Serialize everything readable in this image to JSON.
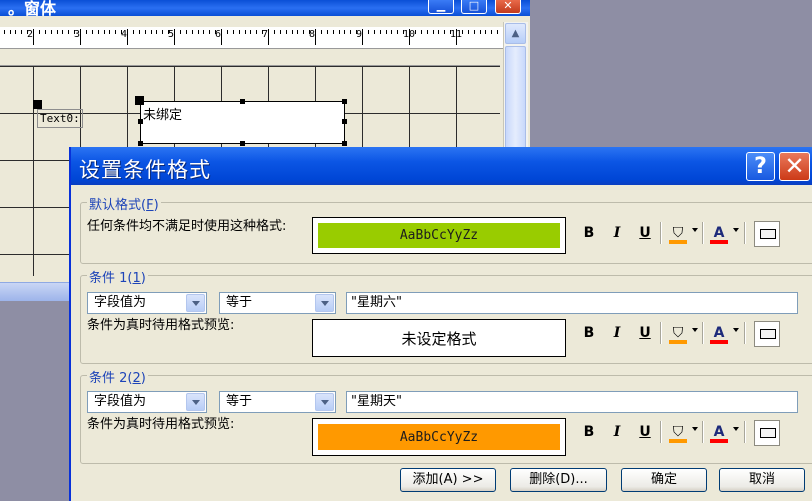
{
  "bg_window": {
    "title": "。窗体",
    "ruler_numbers": [
      "2",
      "3",
      "4",
      "5",
      "6",
      "7",
      "8",
      "9",
      "10",
      "11"
    ],
    "label_text": "Text0:",
    "textbox_text": "未绑定"
  },
  "dialog": {
    "title": "设置条件格式",
    "help_glyph": "?",
    "close_glyph": "✕"
  },
  "default_format": {
    "title": "默认格式",
    "title_key": "F",
    "description": "任何条件均不满足时使用这种格式:",
    "preview_text": "AaBbCcYyZz",
    "preview_color": "#99cc00"
  },
  "condition1": {
    "title": "条件 1",
    "title_key": "1",
    "field_combo": "字段值为",
    "op_combo": "等于",
    "value": "\"星期六\"",
    "preview_label": "条件为真时待用格式预览:",
    "preview_text": "未设定格式"
  },
  "condition2": {
    "title": "条件 2",
    "title_key": "2",
    "field_combo": "字段值为",
    "op_combo": "等于",
    "value": "\"星期天\"",
    "preview_label": "条件为真时待用格式预览:",
    "preview_text": "AaBbCcYyZz",
    "preview_color": "#ff9900"
  },
  "format_toolbar": {
    "bold": "B",
    "italic": "I",
    "underline": "U",
    "font_color_glyph": "A",
    "fill_color": "#ff9900",
    "font_color": "#ff0000"
  },
  "buttons": {
    "add": "添加(A) >>",
    "delete": "删除(D)...",
    "ok": "确定",
    "cancel": "取消"
  }
}
